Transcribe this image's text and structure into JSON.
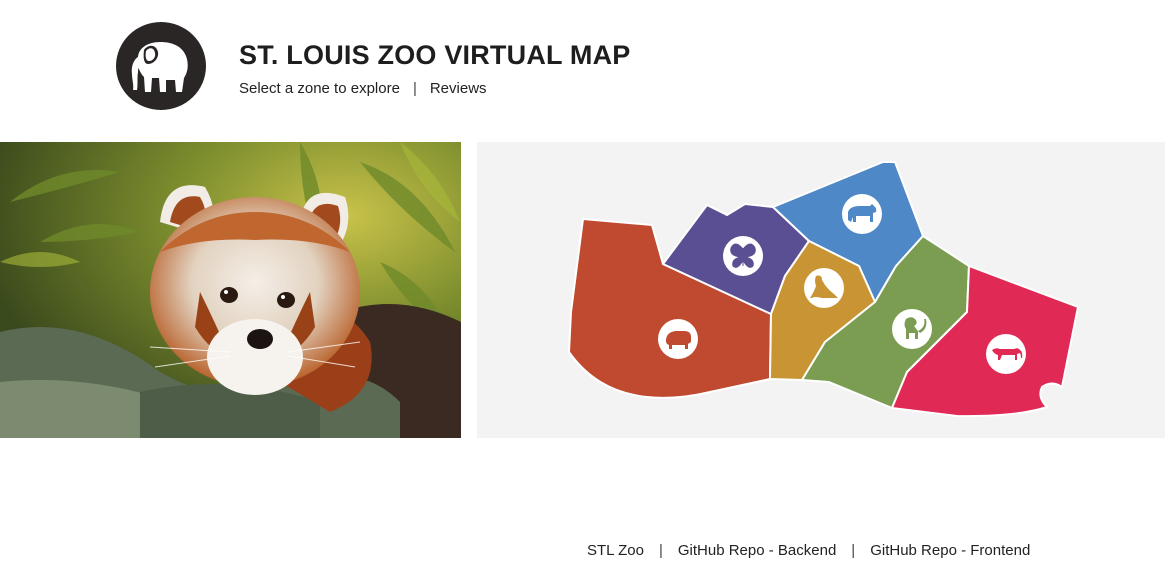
{
  "header": {
    "logo_icon": "elephant-icon",
    "title": "ST. LOUIS ZOO VIRTUAL MAP",
    "nav": {
      "select_zone_label": "Select a zone to explore",
      "separator": "|",
      "reviews_label": "Reviews"
    }
  },
  "hero_image": {
    "subject_icon": "red-panda-photo"
  },
  "map": {
    "background": "#f3f3f3",
    "zones": [
      {
        "icon": "hippo-icon",
        "color": "#c04a2f"
      },
      {
        "icon": "butterfly-icon",
        "color": "#5b4f94"
      },
      {
        "icon": "bear-icon",
        "color": "#4f88c6"
      },
      {
        "icon": "sea-lion-icon",
        "color": "#c99433"
      },
      {
        "icon": "monkey-icon",
        "color": "#7b9d52"
      },
      {
        "icon": "big-cat-icon",
        "color": "#e02a55"
      }
    ]
  },
  "footer": {
    "links": [
      "STL Zoo",
      "GitHub Repo - Backend",
      "GitHub Repo - Frontend"
    ],
    "separator": "|"
  }
}
